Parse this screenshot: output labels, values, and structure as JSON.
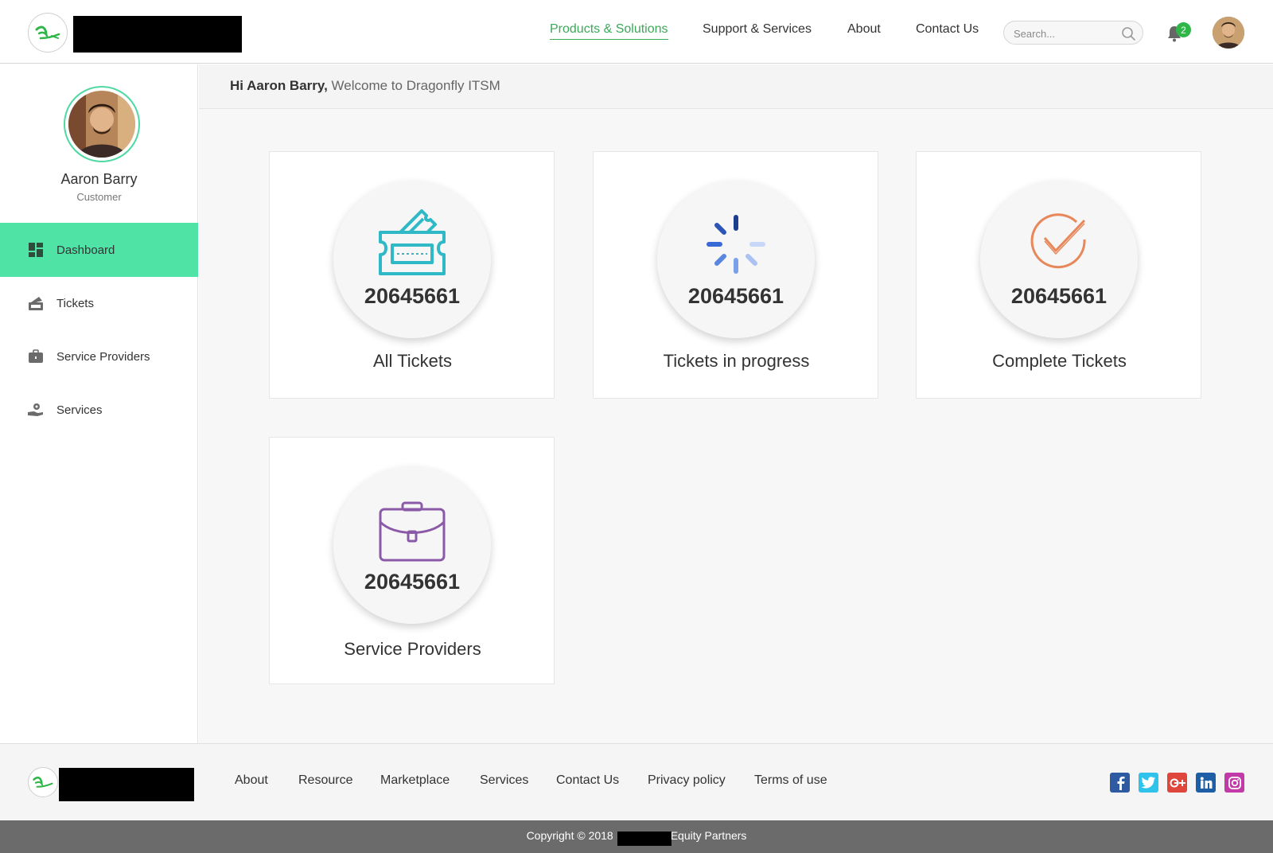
{
  "header": {
    "nav": [
      {
        "label": "Products & Solutions",
        "active": true
      },
      {
        "label": "Support & Services",
        "active": false
      },
      {
        "label": "About",
        "active": false
      },
      {
        "label": "Contact Us",
        "active": false
      }
    ],
    "search_placeholder": "Search...",
    "notification_count": "2",
    "accent_color": "#3aa957"
  },
  "sidebar": {
    "user_name": "Aaron Barry",
    "user_role": "Customer",
    "items": [
      {
        "label": "Dashboard",
        "icon": "dashboard-icon",
        "active": true
      },
      {
        "label": "Tickets",
        "icon": "tickets-icon",
        "active": false
      },
      {
        "label": "Service Providers",
        "icon": "briefcase-icon",
        "active": false
      },
      {
        "label": "Services",
        "icon": "hand-gear-icon",
        "active": false
      }
    ],
    "active_color": "#4fe3a6"
  },
  "main": {
    "greeting_bold": "Hi Aaron Barry,",
    "greeting_rest": "Welcome to Dragonfly ITSM",
    "cards": [
      {
        "count": "20645661",
        "title": "All Tickets",
        "icon": "ticket-icon",
        "color": "#2fb8c6"
      },
      {
        "count": "20645661",
        "title": "Tickets in progress",
        "icon": "spinner-icon",
        "color": "#3b6fd6"
      },
      {
        "count": "20645661",
        "title": "Complete Tickets",
        "icon": "check-circle-icon",
        "color": "#e8875a"
      },
      {
        "count": "20645661",
        "title": "Service Providers",
        "icon": "briefcase-icon",
        "color": "#8a5aa8"
      }
    ]
  },
  "footer": {
    "links": [
      "About",
      "Resource",
      "Marketplace",
      "Services",
      "Contact Us",
      "Privacy policy",
      "Terms of use"
    ],
    "social": [
      "facebook-icon",
      "twitter-icon",
      "google-plus-icon",
      "linkedin-icon",
      "instagram-icon"
    ],
    "copyright_prefix": "Copyright © 2018",
    "copyright_suffix": "Equity Partners"
  }
}
